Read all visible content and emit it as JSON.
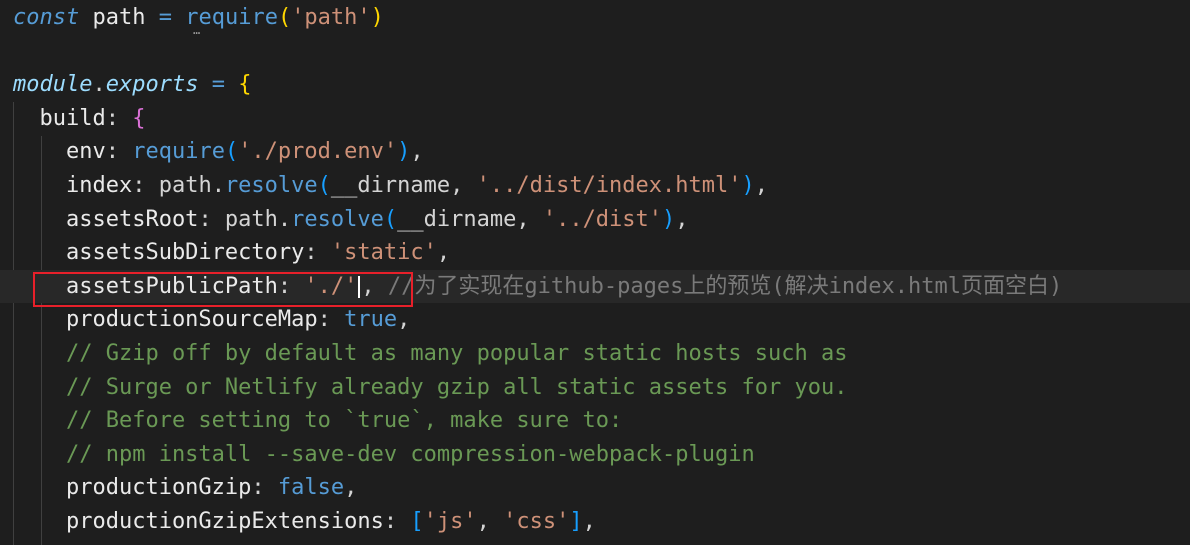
{
  "lines": [
    {
      "tokens": [
        {
          "t": "const",
          "c": "kw"
        },
        {
          "t": " path ",
          "c": "prop"
        },
        {
          "t": "=",
          "c": "kw"
        },
        {
          "t": " ",
          "c": "punc"
        },
        {
          "t": "require",
          "c": "fn"
        },
        {
          "t": "(",
          "c": "br-gold"
        },
        {
          "t": "'path'",
          "c": "str"
        },
        {
          "t": ")",
          "c": "br-gold"
        }
      ]
    },
    {
      "tokens": []
    },
    {
      "tokens": [
        {
          "t": "module",
          "c": "var"
        },
        {
          "t": ".",
          "c": "punc"
        },
        {
          "t": "exports",
          "c": "var"
        },
        {
          "t": " ",
          "c": "punc"
        },
        {
          "t": "=",
          "c": "kw"
        },
        {
          "t": " ",
          "c": "punc"
        },
        {
          "t": "{",
          "c": "br-gold"
        }
      ]
    },
    {
      "tokens": [
        {
          "t": "  build",
          "c": "prop"
        },
        {
          "t": ": ",
          "c": "punc"
        },
        {
          "t": "{",
          "c": "br-pink"
        }
      ]
    },
    {
      "tokens": [
        {
          "t": "    env",
          "c": "prop"
        },
        {
          "t": ": ",
          "c": "punc"
        },
        {
          "t": "require",
          "c": "fn"
        },
        {
          "t": "(",
          "c": "br-blue"
        },
        {
          "t": "'./prod.env'",
          "c": "str"
        },
        {
          "t": ")",
          "c": "br-blue"
        },
        {
          "t": ",",
          "c": "punc"
        }
      ]
    },
    {
      "tokens": [
        {
          "t": "    index",
          "c": "prop"
        },
        {
          "t": ": path.",
          "c": "punc"
        },
        {
          "t": "resolve",
          "c": "fn"
        },
        {
          "t": "(",
          "c": "br-blue"
        },
        {
          "t": "__dirname, ",
          "c": "punc"
        },
        {
          "t": "'../dist/index.html'",
          "c": "str"
        },
        {
          "t": ")",
          "c": "br-blue"
        },
        {
          "t": ",",
          "c": "punc"
        }
      ]
    },
    {
      "tokens": [
        {
          "t": "    assetsRoot",
          "c": "prop"
        },
        {
          "t": ": path.",
          "c": "punc"
        },
        {
          "t": "resolve",
          "c": "fn"
        },
        {
          "t": "(",
          "c": "br-blue"
        },
        {
          "t": "__dirname, ",
          "c": "punc"
        },
        {
          "t": "'../dist'",
          "c": "str"
        },
        {
          "t": ")",
          "c": "br-blue"
        },
        {
          "t": ",",
          "c": "punc"
        }
      ]
    },
    {
      "tokens": [
        {
          "t": "    assetsSubDirectory",
          "c": "prop"
        },
        {
          "t": ": ",
          "c": "punc"
        },
        {
          "t": "'static'",
          "c": "str"
        },
        {
          "t": ",",
          "c": "punc"
        }
      ]
    },
    {
      "current": true,
      "tokens": [
        {
          "t": "    assetsPublicPath",
          "c": "prop"
        },
        {
          "t": ": ",
          "c": "punc"
        },
        {
          "t": "'./'",
          "c": "str"
        },
        {
          "t": "CARET",
          "c": "caret"
        },
        {
          "t": ", ",
          "c": "punc"
        },
        {
          "t": "//为了实现在github-pages上的预览(解决index.html页面空白)",
          "c": "com-gray"
        }
      ]
    },
    {
      "tokens": [
        {
          "t": "    productionSourceMap",
          "c": "prop"
        },
        {
          "t": ": ",
          "c": "punc"
        },
        {
          "t": "true",
          "c": "bool"
        },
        {
          "t": ",",
          "c": "punc"
        }
      ]
    },
    {
      "tokens": [
        {
          "t": "    // Gzip off by default as many popular static hosts such as",
          "c": "com"
        }
      ]
    },
    {
      "tokens": [
        {
          "t": "    // Surge or Netlify already gzip all static assets for you.",
          "c": "com"
        }
      ]
    },
    {
      "tokens": [
        {
          "t": "    // Before setting to `true`, make sure to:",
          "c": "com"
        }
      ]
    },
    {
      "tokens": [
        {
          "t": "    // npm install --save-dev compression-webpack-plugin",
          "c": "com"
        }
      ]
    },
    {
      "tokens": [
        {
          "t": "    productionGzip",
          "c": "prop"
        },
        {
          "t": ": ",
          "c": "punc"
        },
        {
          "t": "false",
          "c": "bool"
        },
        {
          "t": ",",
          "c": "punc"
        }
      ]
    },
    {
      "tokens": [
        {
          "t": "    productionGzipExtensions",
          "c": "prop"
        },
        {
          "t": ": ",
          "c": "punc"
        },
        {
          "t": "[",
          "c": "br-blue"
        },
        {
          "t": "'js'",
          "c": "str"
        },
        {
          "t": ", ",
          "c": "punc"
        },
        {
          "t": "'css'",
          "c": "str"
        },
        {
          "t": "]",
          "c": "br-blue"
        },
        {
          "t": ",",
          "c": "punc"
        }
      ]
    }
  ]
}
